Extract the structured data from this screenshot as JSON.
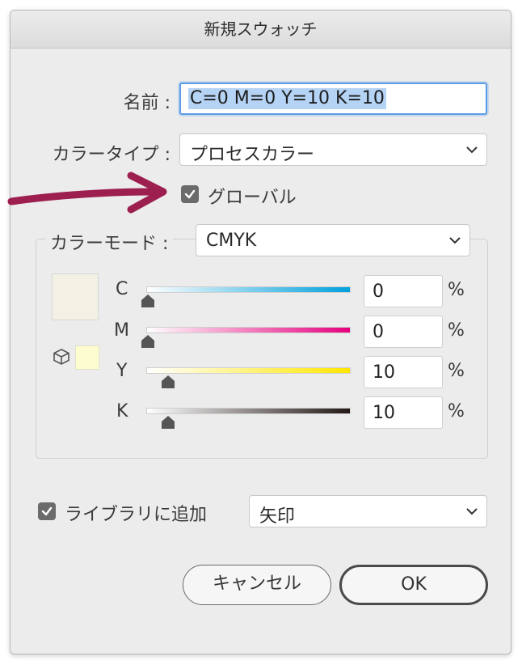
{
  "dialog": {
    "title": "新規スウォッチ",
    "name_label": "名前 :",
    "name_value": "C=0 M=0 Y=10 K=10",
    "color_type_label": "カラータイプ :",
    "color_type_value": "プロセスカラー",
    "global_label": "グローバル",
    "global_checked": true,
    "color_mode_label": "カラーモード :",
    "color_mode_value": "CMYK",
    "channels": [
      {
        "letter": "C",
        "value": "0",
        "unit": "%",
        "level": 0.0,
        "gradient": [
          "#ffffff",
          "#00a0dc"
        ]
      },
      {
        "letter": "M",
        "value": "0",
        "unit": "%",
        "level": 0.0,
        "gradient": [
          "#ffffff",
          "#e6007e"
        ]
      },
      {
        "letter": "Y",
        "value": "10",
        "unit": "%",
        "level": 0.1,
        "gradient": [
          "#ffffff",
          "#ffe600"
        ]
      },
      {
        "letter": "K",
        "value": "10",
        "unit": "%",
        "level": 0.1,
        "gradient": [
          "#ffffff",
          "#231815"
        ]
      }
    ],
    "add_to_library_label": "ライブラリに追加",
    "add_to_library_checked": true,
    "library_value": "矢印",
    "cancel_label": "キャンセル",
    "ok_label": "OK",
    "colors": {
      "accent": "#5b9be6",
      "arrow": "#9c1f4f",
      "swatch_preview": "#f2f1e4",
      "swatch_small": "#fdfcd1"
    }
  }
}
